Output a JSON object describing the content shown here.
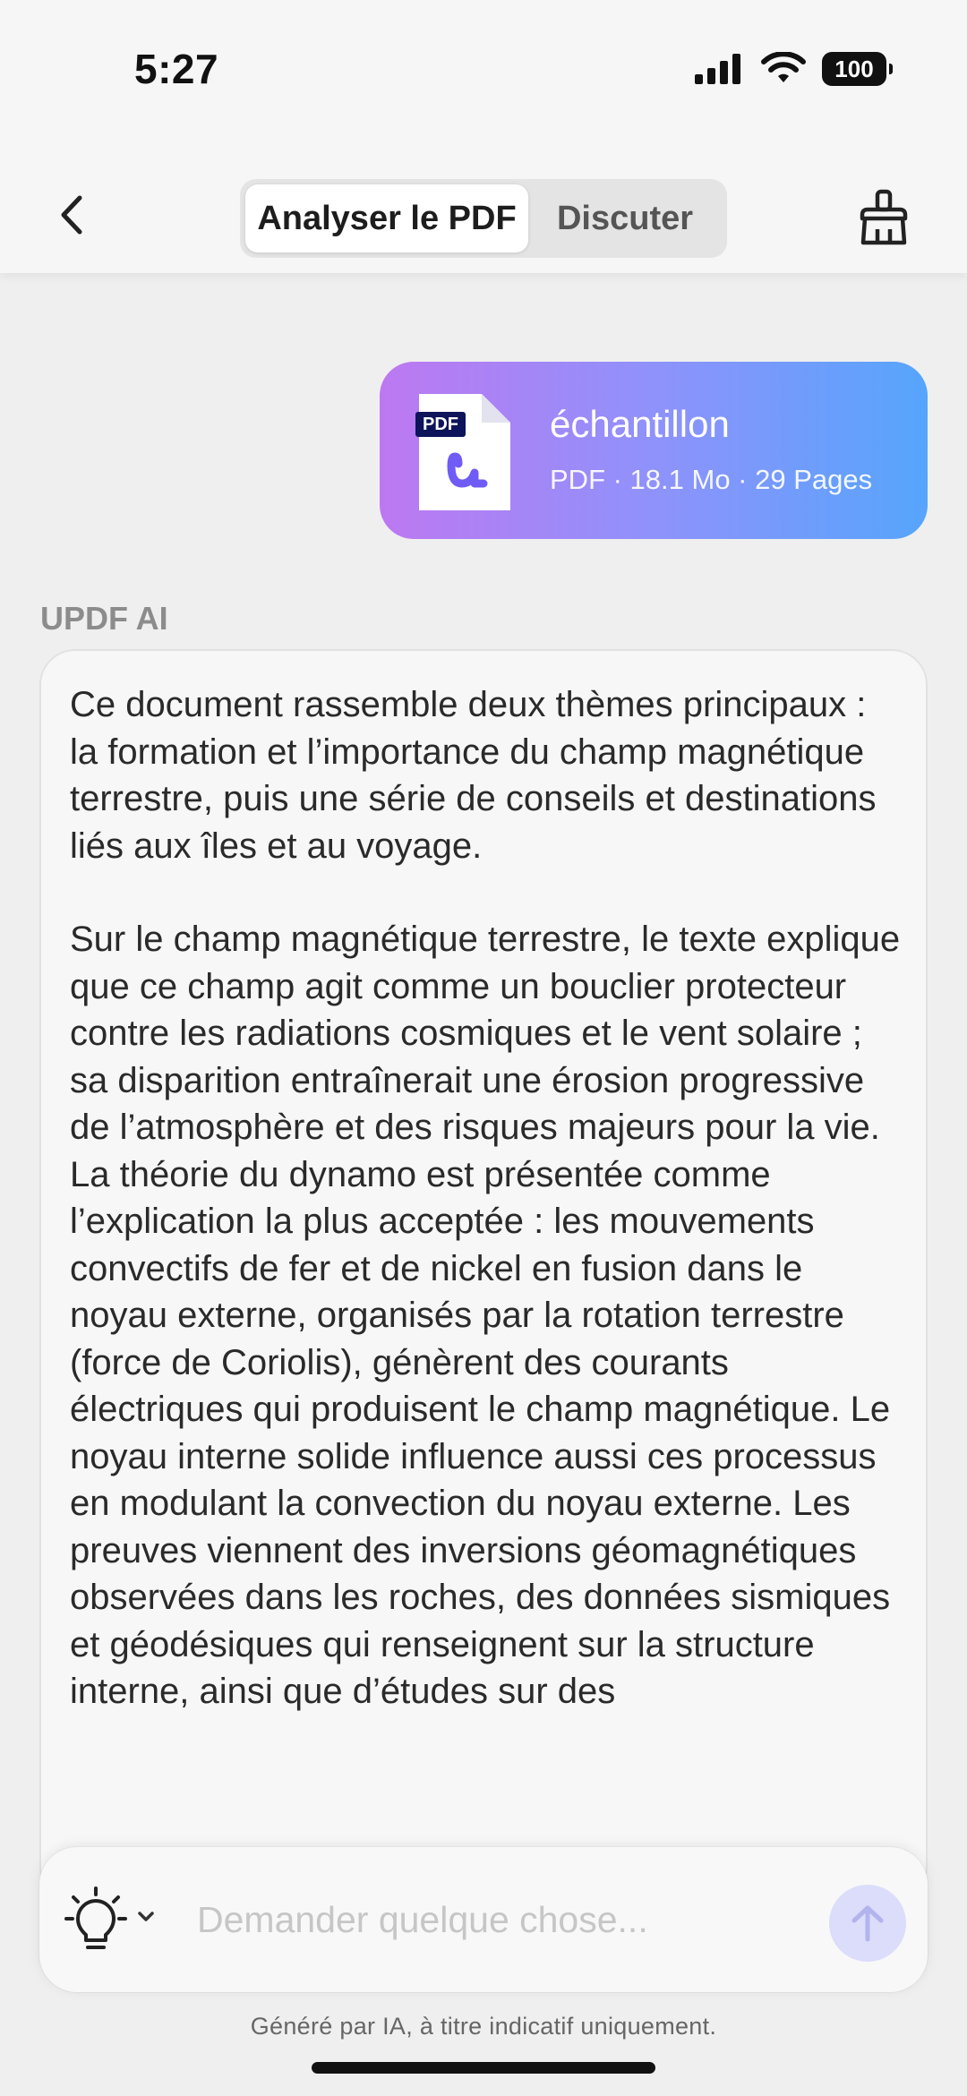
{
  "status": {
    "time": "5:27",
    "battery": "100"
  },
  "nav": {
    "tabs": [
      {
        "label": "Analyser le PDF",
        "active": true
      },
      {
        "label": "Discuter",
        "active": false
      }
    ]
  },
  "file": {
    "badge": "PDF",
    "name": "échantillon",
    "meta": "PDF · 18.1 Mo · 29 Pages"
  },
  "assistant": {
    "label": "UPDF AI",
    "paragraphs": [
      "Ce document rassemble deux thèmes principaux : la formation et l’importance du champ magnétique terrestre, puis une série de conseils et destinations liés aux îles et au voyage.",
      "Sur le champ magnétique terrestre, le texte explique que ce champ agit comme un bouclier protecteur contre les radiations cosmiques et le vent solaire ; sa disparition entraînerait une érosion progressive de l’atmosphère et des risques majeurs pour la vie. La théorie du dynamo est présentée comme l’explication la plus acceptée : les mouvements convectifs de fer et de nickel en fusion dans le noyau externe, organisés par la rotation terrestre (force de Coriolis), génèrent des courants électriques qui produisent le champ magnétique. Le noyau interne solide influence aussi ces processus en modulant la convection du noyau externe. Les preuves viennent des inversions géomagnétiques observées dans les roches, des données sismiques et géodésiques qui renseignent sur la structure interne, ainsi que d’études sur des"
    ]
  },
  "input": {
    "placeholder": "Demander quelque chose..."
  },
  "footer": {
    "disclaimer": "Généré par IA, à titre indicatif uniquement."
  },
  "colors": {
    "gradient_start": "#bd78f1",
    "gradient_end": "#56a5fc",
    "send_button": "#dcdcfb"
  }
}
